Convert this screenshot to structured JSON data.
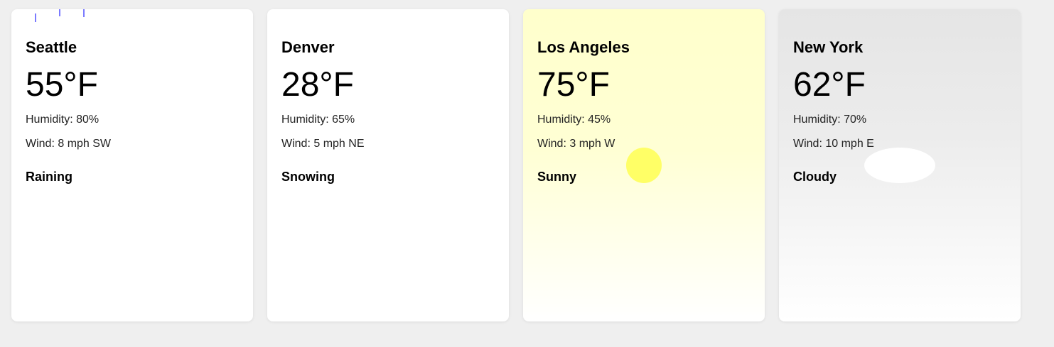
{
  "cards": [
    {
      "city": "Seattle",
      "temperature": "55°F",
      "humidity": "Humidity: 80%",
      "wind": "Wind: 8 mph SW",
      "condition": "Raining",
      "effect_icon": "rain-drops-icon"
    },
    {
      "city": "Denver",
      "temperature": "28°F",
      "humidity": "Humidity: 65%",
      "wind": "Wind: 5 mph NE",
      "condition": "Snowing",
      "effect_icon": "snow-icon"
    },
    {
      "city": "Los Angeles",
      "temperature": "75°F",
      "humidity": "Humidity: 45%",
      "wind": "Wind: 3 mph W",
      "condition": "Sunny",
      "effect_icon": "sun-icon"
    },
    {
      "city": "New York",
      "temperature": "62°F",
      "humidity": "Humidity: 70%",
      "wind": "Wind: 10 mph E",
      "condition": "Cloudy",
      "effect_icon": "cloud-icon"
    }
  ],
  "colors": {
    "page_background": "#efefef",
    "card_background": "#ffffff",
    "rain": "#7b7bff",
    "sun": "#ffff66",
    "sunny_tint": "#ffffcc",
    "cloudy_tint": "#e5e5e5"
  }
}
